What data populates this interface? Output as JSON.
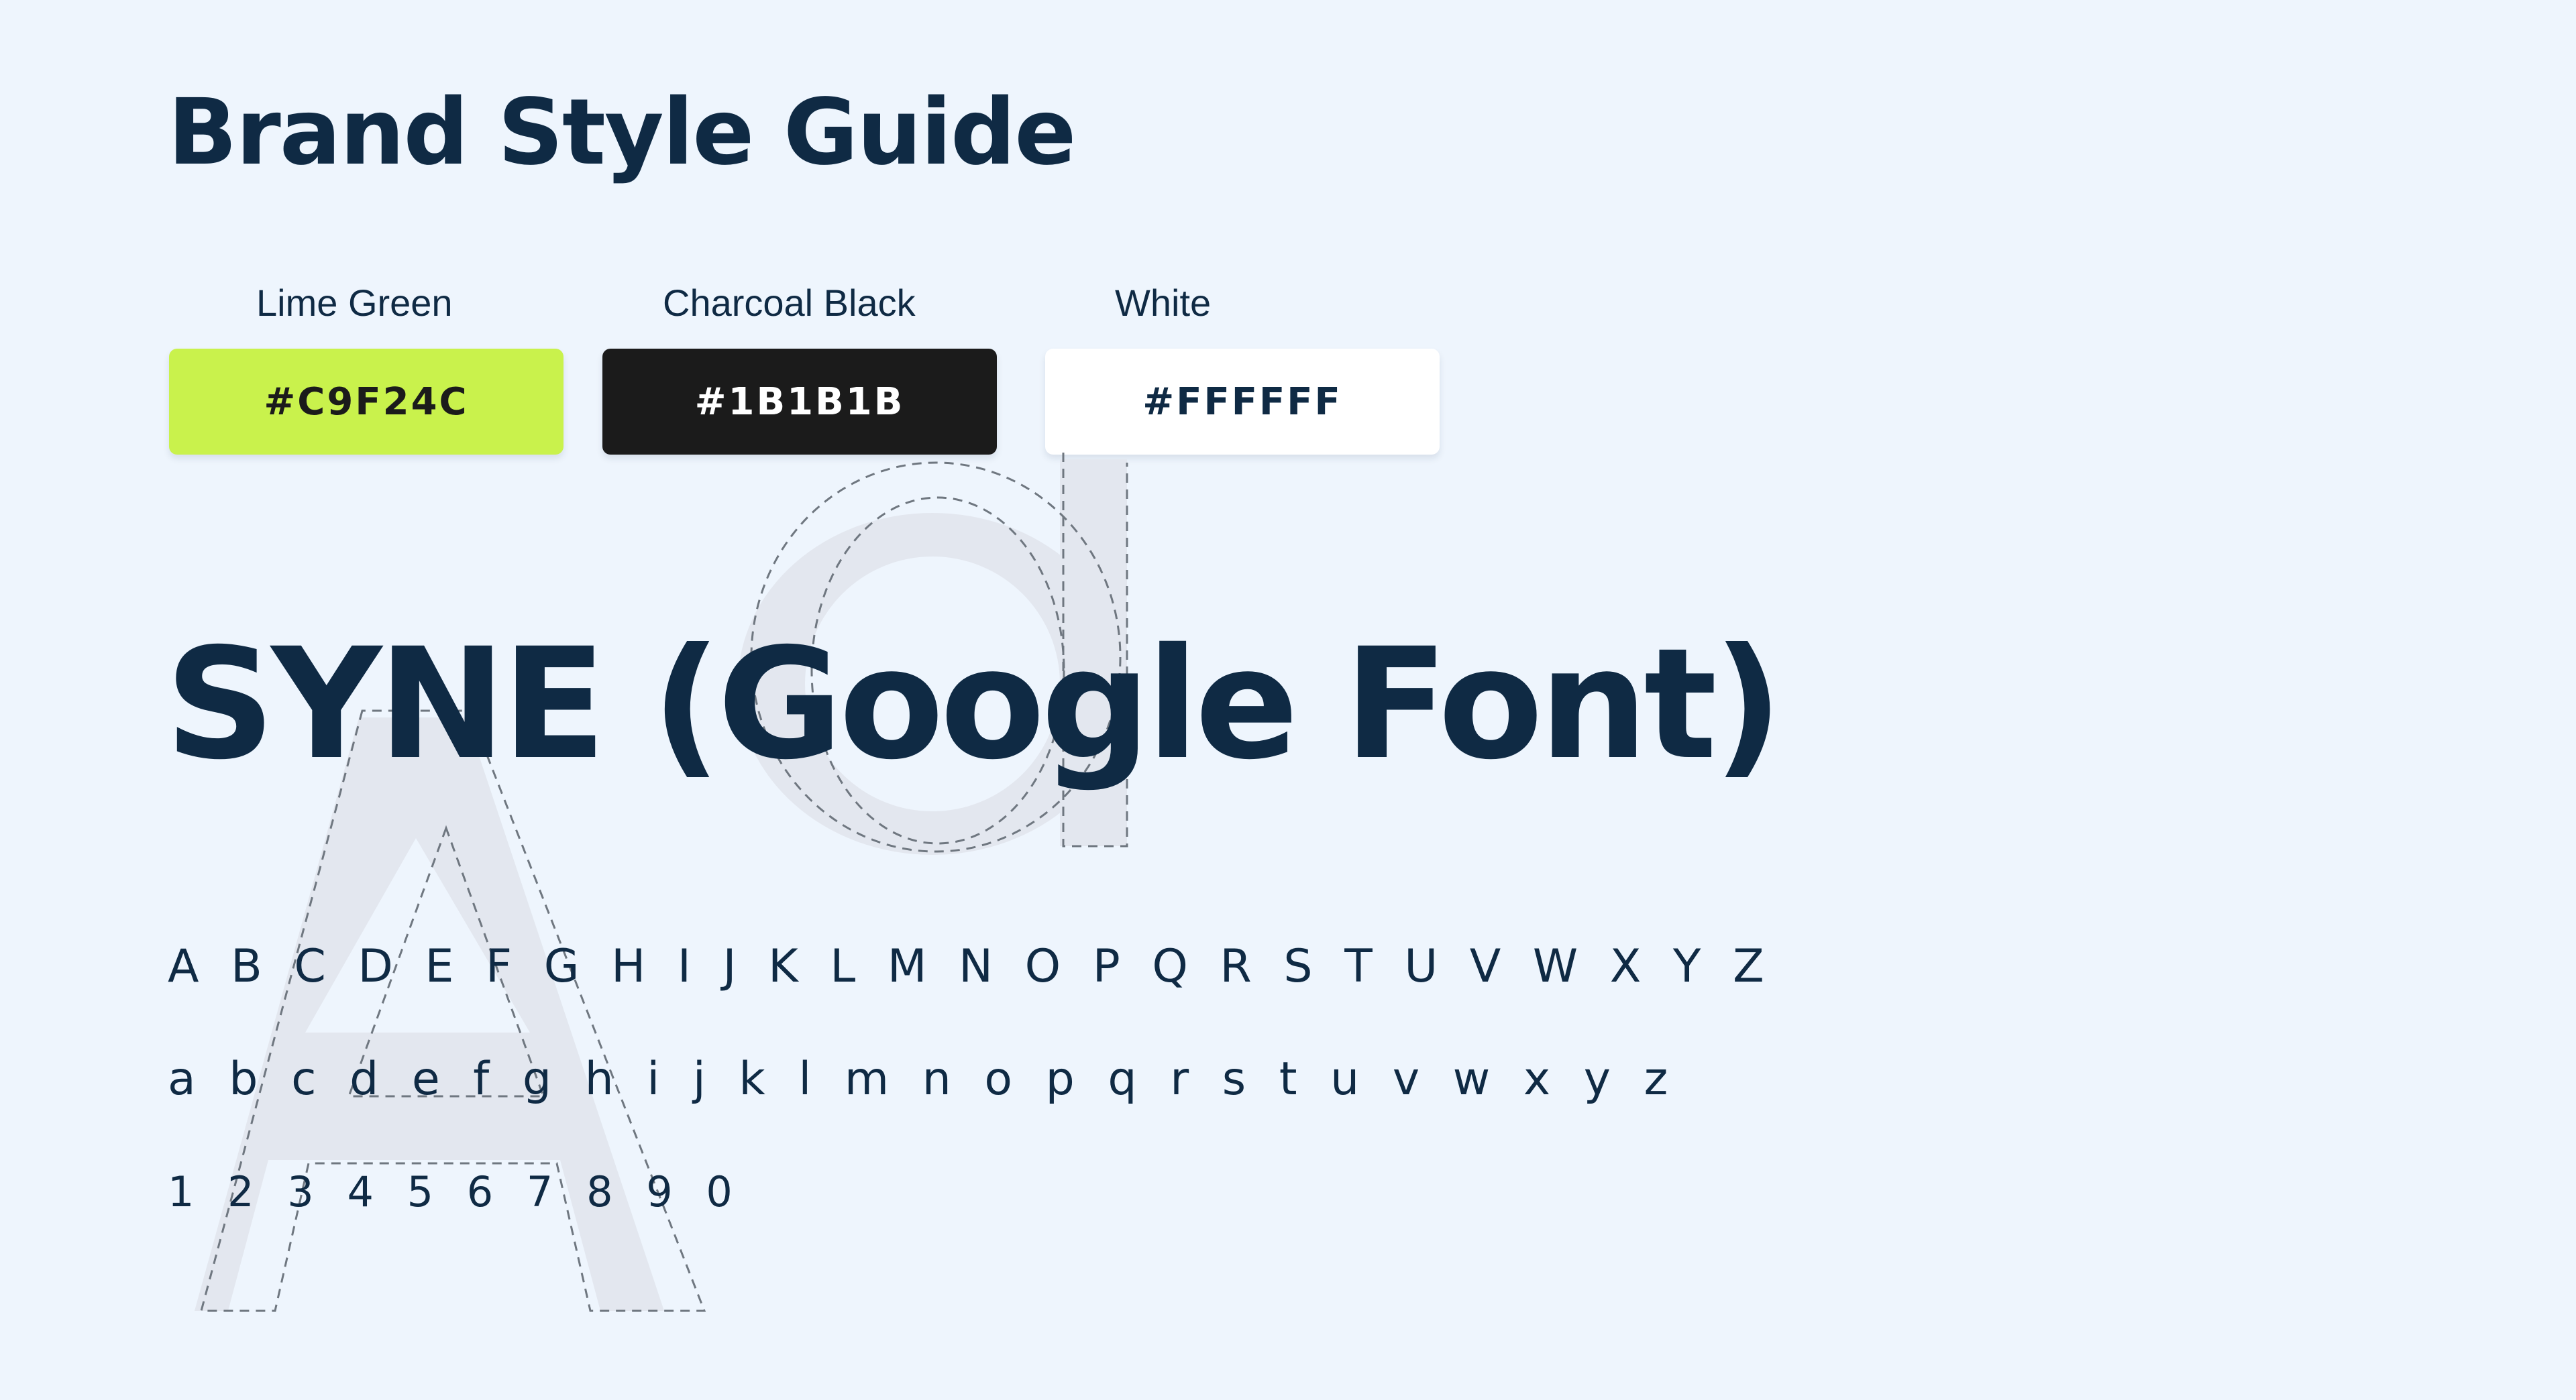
{
  "title": "Brand Style Guide",
  "swatches": [
    {
      "name": "Lime Green",
      "hex": "#C9F24C",
      "color": "#C9F24C",
      "text_color": "#1B1B1B"
    },
    {
      "name": "Charcoal Black",
      "hex": "#1B1B1B",
      "color": "#1B1B1B",
      "text_color": "#FFFFFF"
    },
    {
      "name": "White",
      "hex": "#FFFFFF",
      "color": "#FFFFFF",
      "text_color": "#0F2A44"
    }
  ],
  "font_name": "SYNE (Google Font)",
  "glyphs": {
    "uppercase": "A B C D E F G H I J K L M N O P Q R S T U V W X Y Z",
    "lowercase": "a b c d e f g h i j k l m n o p q r s t u v w x y z",
    "numerals": "1 2 3 4 5 6 7 8 9 0"
  },
  "colors": {
    "background": "#EEF5FD",
    "text": "#0F2A44",
    "decor_fill": "#E2E6EE",
    "decor_outline": "#6F7780"
  }
}
